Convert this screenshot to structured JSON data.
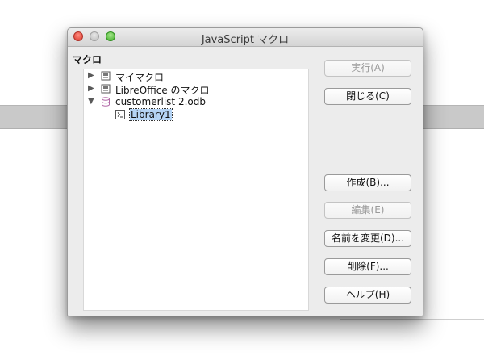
{
  "dialog": {
    "title": "JavaScript マクロ",
    "group_label": "マクロ"
  },
  "tree": {
    "items": [
      {
        "label": "マイマクロ",
        "icon": "dialog-container-icon",
        "expanded": false
      },
      {
        "label": "LibreOffice のマクロ",
        "icon": "dialog-container-icon",
        "expanded": false
      },
      {
        "label": "customerlist 2.odb",
        "icon": "database-icon",
        "expanded": true
      },
      {
        "label": "Library1",
        "icon": "library-icon",
        "selected": true
      }
    ]
  },
  "buttons": {
    "run": "実行(A)",
    "close": "閉じる(C)",
    "create": "作成(B)...",
    "edit": "編集(E)",
    "rename": "名前を変更(D)...",
    "delete": "削除(F)...",
    "help": "ヘルプ(H)"
  },
  "colors": {
    "selection": "#b5d4f5",
    "database_icon": "#b26aa8",
    "close_button": "#e0443a",
    "maximize_button": "#43b02a"
  }
}
